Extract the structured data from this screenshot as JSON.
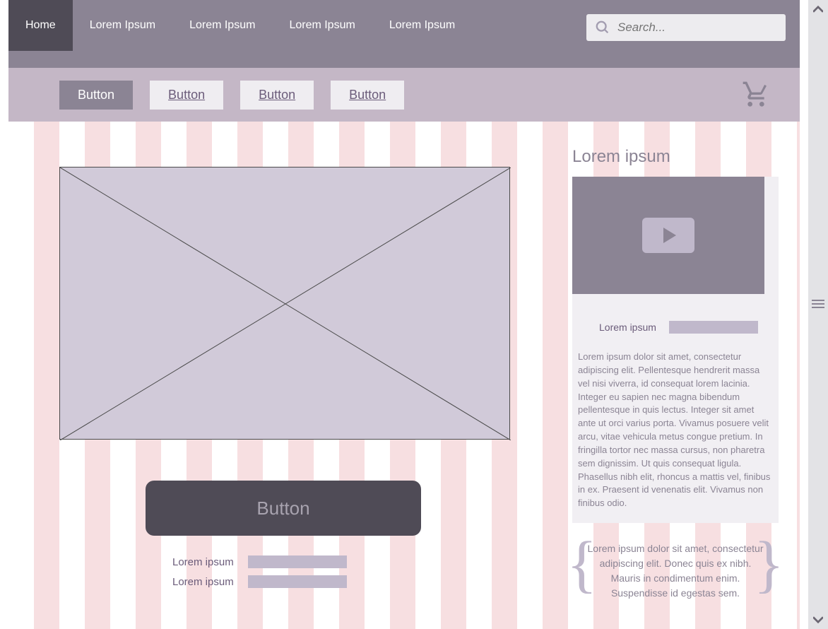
{
  "nav": {
    "items": [
      {
        "label": "Home",
        "active": true
      },
      {
        "label": "Lorem Ipsum",
        "active": false
      },
      {
        "label": "Lorem Ipsum",
        "active": false
      },
      {
        "label": "Lorem Ipsum",
        "active": false
      },
      {
        "label": "Lorem Ipsum",
        "active": false
      }
    ],
    "search_placeholder": "Search..."
  },
  "subnav": {
    "buttons": [
      {
        "label": "Button",
        "primary": true
      },
      {
        "label": "Button",
        "primary": false
      },
      {
        "label": "Button",
        "primary": false
      },
      {
        "label": "Button",
        "primary": false
      }
    ]
  },
  "main": {
    "cta_label": "Button",
    "labels": [
      {
        "text": "Lorem ipsum"
      },
      {
        "text": "Lorem ipsum"
      }
    ]
  },
  "aside": {
    "heading": "Lorem ipsum",
    "field_label": "Lorem ipsum",
    "body": "Lorem ipsum dolor sit amet, consectetur adipiscing elit. Pellentesque hendrerit massa vel nisi viverra, id consequat lorem lacinia. Integer eu sapien nec magna bibendum pellentesque in quis lectus. Integer sit amet ante ut orci varius porta. Vivamus posuere velit arcu, vitae vehicula metus congue pretium. In fringilla tortor nec massa cursus, non pharetra sem dignissim. Ut quis consequat ligula. Phasellus nibh elit, rhoncus a mattis vel, finibus in ex. Praesent id venenatis elit. Vivamus non finibus odio.",
    "note": "Lorem ipsum dolor sit amet, consectetur adipiscing elit. Donec quis ex nibh. Mauris in condimentum enim. Suspendisse id egestas sem."
  }
}
